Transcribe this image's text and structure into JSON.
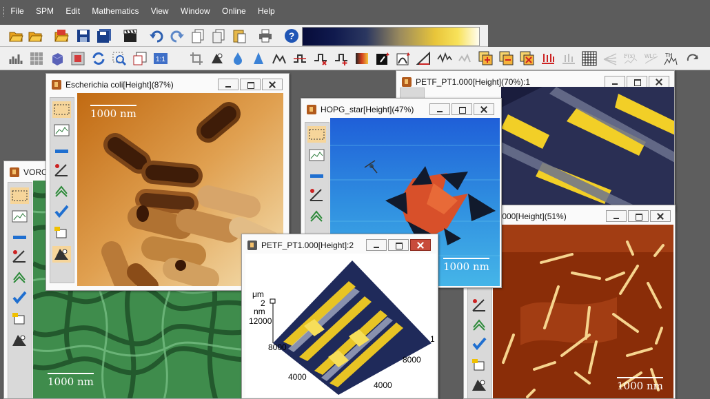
{
  "menu": [
    "File",
    "SPM",
    "Edit",
    "Mathematics",
    "View",
    "Window",
    "Online",
    "Help"
  ],
  "windows": {
    "voronoi": {
      "title": "VORO",
      "scale_bar": "1000 nm"
    },
    "ecoli": {
      "title": "Escherichia coli[Height](87%)",
      "scale_bar": "1000 nm"
    },
    "petf70": {
      "title": "PETF_PT1.000[Height](70%):1"
    },
    "hopg": {
      "title": "HOPG_star[Height](47%)",
      "scale_bar": "1000 nm"
    },
    "petf51": {
      "title": ".000[Height](51%)",
      "scale_bar": "1000 nm"
    },
    "petf3d": {
      "title": "PETF_PT1.000[Height]:2",
      "z_unit": "μm",
      "z_tick": "2",
      "axis_unit": "nm",
      "left_ticks": [
        "12000",
        "8000",
        "4000"
      ],
      "right_ticks": [
        "1",
        "8000",
        "4000"
      ]
    }
  },
  "icons": {
    "toolbar1": [
      "open-folder-icon",
      "open-folder-icon",
      "open-image-folder-icon",
      "save-icon",
      "save-all-icon",
      "clapperboard-icon",
      "undo-icon",
      "redo-icon",
      "copy-icon",
      "copy-icon",
      "paste-icon",
      "print-icon",
      "help-icon"
    ],
    "toolbar2": [
      "histogram-icon",
      "grid-icon",
      "cube-icon",
      "frame-icon",
      "refresh-icon",
      "zoom-icon",
      "new-window-icon",
      "ratio-icon",
      "crop-icon",
      "shading-icon",
      "drop-icon",
      "cone-icon",
      "profile-icon",
      "step-icon",
      "step-x-icon",
      "step-plus-icon",
      "color-map-icon",
      "rotate-icon",
      "curve-icon",
      "flip-icon",
      "level-icon",
      "wave-icon",
      "plus-box-icon",
      "minus-box-icon",
      "x-box-icon",
      "bars-icon",
      "bars-grid-icon",
      "matrix-icon",
      "fan-icon",
      "formula-icon",
      "wlc-icon",
      "th-icon",
      "more-icon"
    ],
    "tools": [
      "selection-rect-icon",
      "profile-line-icon",
      "line-tool-icon",
      "angle-tool-icon",
      "hexagon-tool-icon",
      "check-icon",
      "eraser-icon",
      "level-tool-icon"
    ]
  },
  "colors": {
    "palette_gradient": [
      "#0a0f3c",
      "#1b2a55",
      "#c8a855",
      "#f6dc2e",
      "#ffffff"
    ]
  }
}
